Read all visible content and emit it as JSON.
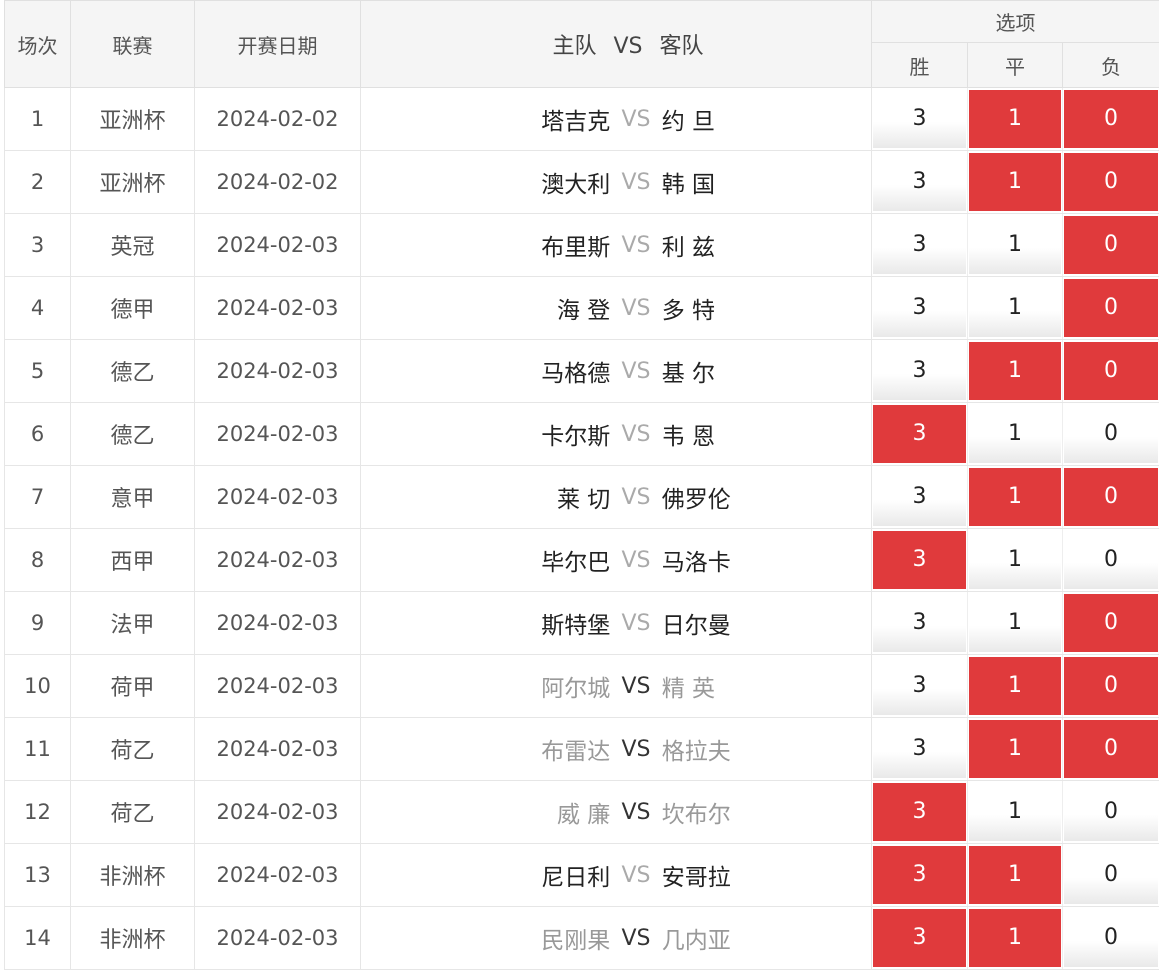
{
  "headers": {
    "no": "场次",
    "league": "联赛",
    "date": "开赛日期",
    "home": "主队",
    "vs": "VS",
    "away": "客队",
    "options": "选项",
    "win": "胜",
    "draw": "平",
    "lose": "负"
  },
  "colors": {
    "selected": "#e03a3c",
    "muted_team": "#999999"
  },
  "rows": [
    {
      "no": "1",
      "league": "亚洲杯",
      "date": "2024-02-02",
      "home": "塔吉克",
      "away": "约 旦",
      "muted": false,
      "w": "3",
      "d": "1",
      "l": "0",
      "sel": [
        false,
        true,
        true
      ]
    },
    {
      "no": "2",
      "league": "亚洲杯",
      "date": "2024-02-02",
      "home": "澳大利",
      "away": "韩 国",
      "muted": false,
      "w": "3",
      "d": "1",
      "l": "0",
      "sel": [
        false,
        true,
        true
      ]
    },
    {
      "no": "3",
      "league": "英冠",
      "date": "2024-02-03",
      "home": "布里斯",
      "away": "利 兹",
      "muted": false,
      "w": "3",
      "d": "1",
      "l": "0",
      "sel": [
        false,
        false,
        true
      ]
    },
    {
      "no": "4",
      "league": "德甲",
      "date": "2024-02-03",
      "home": "海 登",
      "away": "多 特",
      "muted": false,
      "w": "3",
      "d": "1",
      "l": "0",
      "sel": [
        false,
        false,
        true
      ]
    },
    {
      "no": "5",
      "league": "德乙",
      "date": "2024-02-03",
      "home": "马格德",
      "away": "基 尔",
      "muted": false,
      "w": "3",
      "d": "1",
      "l": "0",
      "sel": [
        false,
        true,
        true
      ]
    },
    {
      "no": "6",
      "league": "德乙",
      "date": "2024-02-03",
      "home": "卡尔斯",
      "away": "韦 恩",
      "muted": false,
      "w": "3",
      "d": "1",
      "l": "0",
      "sel": [
        true,
        false,
        false
      ]
    },
    {
      "no": "7",
      "league": "意甲",
      "date": "2024-02-03",
      "home": "莱 切",
      "away": "佛罗伦",
      "muted": false,
      "w": "3",
      "d": "1",
      "l": "0",
      "sel": [
        false,
        true,
        true
      ]
    },
    {
      "no": "8",
      "league": "西甲",
      "date": "2024-02-03",
      "home": "毕尔巴",
      "away": "马洛卡",
      "muted": false,
      "w": "3",
      "d": "1",
      "l": "0",
      "sel": [
        true,
        false,
        false
      ]
    },
    {
      "no": "9",
      "league": "法甲",
      "date": "2024-02-03",
      "home": "斯特堡",
      "away": "日尔曼",
      "muted": false,
      "w": "3",
      "d": "1",
      "l": "0",
      "sel": [
        false,
        false,
        true
      ]
    },
    {
      "no": "10",
      "league": "荷甲",
      "date": "2024-02-03",
      "home": "阿尔城",
      "away": "精 英",
      "muted": true,
      "w": "3",
      "d": "1",
      "l": "0",
      "sel": [
        false,
        true,
        true
      ]
    },
    {
      "no": "11",
      "league": "荷乙",
      "date": "2024-02-03",
      "home": "布雷达",
      "away": "格拉夫",
      "muted": true,
      "w": "3",
      "d": "1",
      "l": "0",
      "sel": [
        false,
        true,
        true
      ]
    },
    {
      "no": "12",
      "league": "荷乙",
      "date": "2024-02-03",
      "home": "威 廉",
      "away": "坎布尔",
      "muted": true,
      "w": "3",
      "d": "1",
      "l": "0",
      "sel": [
        true,
        false,
        false
      ]
    },
    {
      "no": "13",
      "league": "非洲杯",
      "date": "2024-02-03",
      "home": "尼日利",
      "away": "安哥拉",
      "muted": false,
      "w": "3",
      "d": "1",
      "l": "0",
      "sel": [
        true,
        true,
        false
      ]
    },
    {
      "no": "14",
      "league": "非洲杯",
      "date": "2024-02-03",
      "home": "民刚果",
      "away": "几内亚",
      "muted": true,
      "w": "3",
      "d": "1",
      "l": "0",
      "sel": [
        true,
        true,
        false
      ]
    }
  ]
}
